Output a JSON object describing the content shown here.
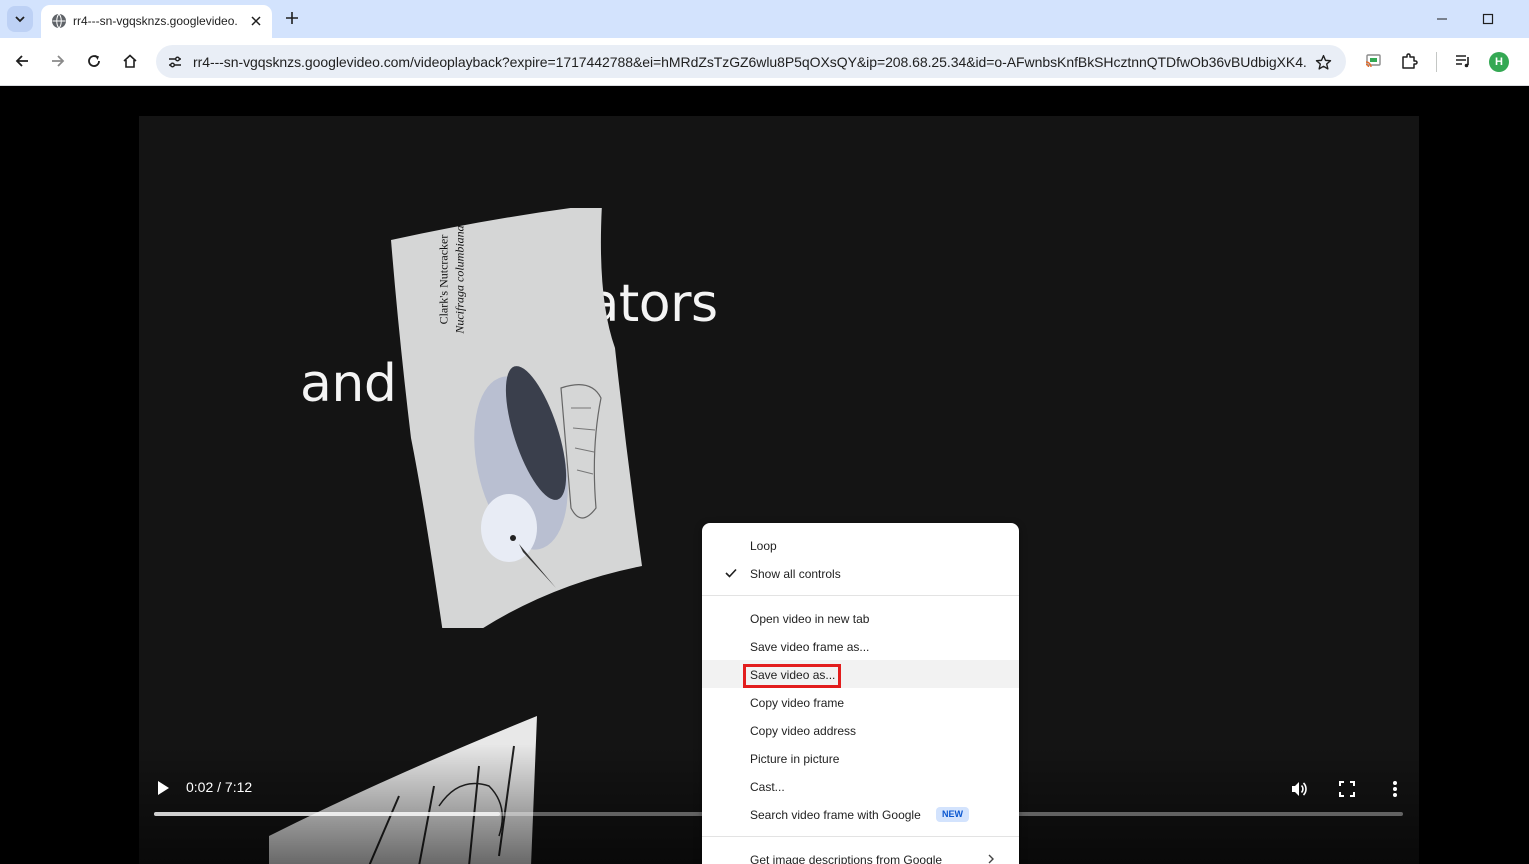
{
  "browser": {
    "tab": {
      "title": "rr4---sn-vgqsknzs.googlevideo."
    },
    "address_bar": {
      "url": "rr4---sn-vgqsknzs.googlevideo.com/videoplayback?expire=1717442788&ei=hMRdZsTzGZ6wlu8P5qOXsQY&ip=208.68.25.34&id=o-AFwnbsKnfBkSHcztnnQTDfwOb36vBUdbigXK4..."
    },
    "profile": {
      "initial": "H"
    }
  },
  "video": {
    "frame_text": {
      "line1_part": "ucators",
      "line2_part": "and"
    },
    "card": {
      "title": "Clark's Nutcracker",
      "subtitle": "Nucifraga columbiana"
    },
    "time": "0:02 / 7:12",
    "buffered_fraction": 0.277,
    "played_fraction": 0.003
  },
  "context_menu": {
    "group1": [
      {
        "label": "Loop",
        "checked": false
      },
      {
        "label": "Show all controls",
        "checked": true
      }
    ],
    "group2": [
      {
        "label": "Open video in new tab"
      },
      {
        "label": "Save video frame as..."
      },
      {
        "label": "Save video as...",
        "highlighted": true
      },
      {
        "label": "Copy video frame"
      },
      {
        "label": "Copy video address"
      },
      {
        "label": "Picture in picture"
      },
      {
        "label": "Cast..."
      },
      {
        "label": "Search video frame with Google",
        "badge": "NEW"
      }
    ],
    "group3": [
      {
        "label": "Get image descriptions from Google"
      }
    ]
  },
  "colors": {
    "tabstrip": "#d3e3fd",
    "omnibox": "#e9eef6",
    "highlight_box": "#e21d1d",
    "avatar": "#34a853"
  }
}
